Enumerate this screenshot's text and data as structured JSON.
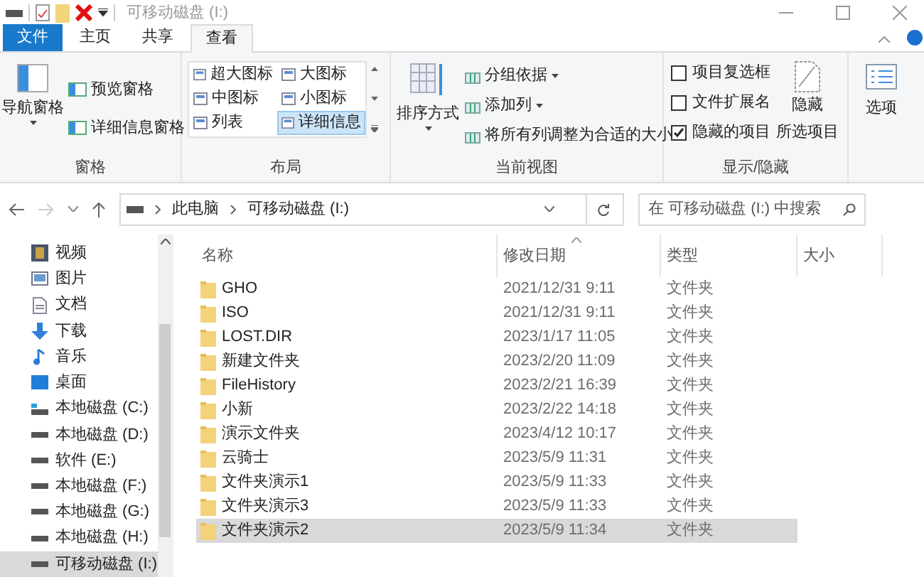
{
  "window": {
    "title": "可移动磁盘 (I:)"
  },
  "ribbon_tabs": [
    {
      "label": "文件",
      "kind": "file",
      "selected": false
    },
    {
      "label": "主页",
      "kind": "tab",
      "selected": false
    },
    {
      "label": "共享",
      "kind": "tab",
      "selected": false
    },
    {
      "label": "查看",
      "kind": "tab",
      "selected": true
    }
  ],
  "panes_group": {
    "label": "窗格",
    "nav_pane": "导航窗格",
    "items": [
      "预览窗格",
      "详细信息窗格"
    ]
  },
  "layout_group": {
    "label": "布局",
    "options": [
      {
        "label": "超大图标",
        "selected": false
      },
      {
        "label": "大图标",
        "selected": false
      },
      {
        "label": "中图标",
        "selected": false
      },
      {
        "label": "小图标",
        "selected": false
      },
      {
        "label": "列表",
        "selected": false
      },
      {
        "label": "详细信息",
        "selected": true
      }
    ]
  },
  "current_view_group": {
    "label": "当前视图",
    "sort": "排序方式",
    "items": [
      {
        "label": "分组依据",
        "dropdown": true
      },
      {
        "label": "添加列",
        "dropdown": true
      },
      {
        "label": "将所有列调整为合适的大小",
        "dropdown": false
      }
    ]
  },
  "show_hide_group": {
    "label": "显示/隐藏",
    "checkboxes": [
      {
        "label": "项目复选框",
        "checked": false
      },
      {
        "label": "文件扩展名",
        "checked": false
      },
      {
        "label": "隐藏的项目",
        "checked": true
      }
    ],
    "hide_selected": [
      "隐藏",
      "所选项目"
    ]
  },
  "options_button": "选项",
  "breadcrumb": [
    "此电脑",
    "可移动磁盘 (I:)"
  ],
  "search": {
    "placeholder": "在 可移动磁盘 (I:) 中搜索"
  },
  "sidebar": {
    "items": [
      {
        "label": "视频",
        "kind": "video",
        "selected": false
      },
      {
        "label": "图片",
        "kind": "pictures",
        "selected": false
      },
      {
        "label": "文档",
        "kind": "documents",
        "selected": false
      },
      {
        "label": "下载",
        "kind": "download",
        "selected": false
      },
      {
        "label": "音乐",
        "kind": "music",
        "selected": false
      },
      {
        "label": "桌面",
        "kind": "desktop",
        "selected": false
      },
      {
        "label": "本地磁盘 (C:)",
        "kind": "system-drive",
        "selected": false
      },
      {
        "label": "本地磁盘 (D:)",
        "kind": "drive",
        "selected": false
      },
      {
        "label": "软件 (E:)",
        "kind": "drive",
        "selected": false
      },
      {
        "label": "本地磁盘 (F:)",
        "kind": "drive",
        "selected": false
      },
      {
        "label": "本地磁盘 (G:)",
        "kind": "drive",
        "selected": false
      },
      {
        "label": "本地磁盘 (H:)",
        "kind": "drive",
        "selected": false
      },
      {
        "label": "可移动磁盘 (I:)",
        "kind": "drive",
        "selected": true
      }
    ]
  },
  "table": {
    "columns": [
      "名称",
      "修改日期",
      "类型",
      "大小"
    ],
    "rows": [
      {
        "name": "GHO",
        "modified": "2021/12/31 9:11",
        "type": "文件夹",
        "selected": false
      },
      {
        "name": "ISO",
        "modified": "2021/12/31 9:11",
        "type": "文件夹",
        "selected": false
      },
      {
        "name": "LOST.DIR",
        "modified": "2023/1/17 11:05",
        "type": "文件夹",
        "selected": false
      },
      {
        "name": "新建文件夹",
        "modified": "2023/2/20 11:09",
        "type": "文件夹",
        "selected": false
      },
      {
        "name": "FileHistory",
        "modified": "2023/2/21 16:39",
        "type": "文件夹",
        "selected": false
      },
      {
        "name": "小新",
        "modified": "2023/2/22 14:18",
        "type": "文件夹",
        "selected": false
      },
      {
        "name": "演示文件夹",
        "modified": "2023/4/12 10:17",
        "type": "文件夹",
        "selected": false
      },
      {
        "name": "云骑士",
        "modified": "2023/5/9 11:31",
        "type": "文件夹",
        "selected": false
      },
      {
        "name": "文件夹演示1",
        "modified": "2023/5/9 11:33",
        "type": "文件夹",
        "selected": false
      },
      {
        "name": "文件夹演示3",
        "modified": "2023/5/9 11:33",
        "type": "文件夹",
        "selected": false
      },
      {
        "name": "文件夹演示2",
        "modified": "2023/5/9 11:34",
        "type": "文件夹",
        "selected": true
      }
    ]
  }
}
